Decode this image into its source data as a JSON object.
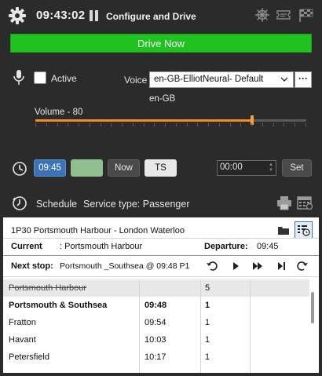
{
  "header": {
    "clock": "09:43:02",
    "title": "Configure and Drive",
    "icons": [
      "gear-icon",
      "pause-icon",
      "ship-wheel-icon",
      "ticket-icon",
      "checkered-flag-icon"
    ]
  },
  "drive_button": {
    "label": "Drive Now",
    "color": "#1fc21f"
  },
  "voice": {
    "active_label": "Active",
    "active_checked": false,
    "voice_label": "Voice",
    "selected": "en-GB-ElliotNeural- Default",
    "more_label": "···",
    "locale": "en-GB"
  },
  "volume": {
    "label": "Volume - 80",
    "value": 80,
    "max": 100,
    "accent": "#f28c1e"
  },
  "time_controls": {
    "time_button": "09:45",
    "now_button": "Now",
    "ts_button": "TS",
    "time_input": "00:00",
    "set_button": "Set"
  },
  "schedule": {
    "label": "Schedule",
    "service_type": "Service type: Passenger"
  },
  "journey": {
    "route": "1P30 Portsmouth Harbour - London Waterloo",
    "current_label": "Current",
    "current_value": ":  Portsmouth Harbour",
    "departure_label": "Departure:",
    "departure_value": "09:45",
    "next_stop_label": "Next stop:",
    "next_stop_value": "Portsmouth _Southsea @ 09:48 P1",
    "controls": [
      "undo-icon",
      "play-icon",
      "fast-forward-icon",
      "skip-to-end-icon",
      "redo-icon"
    ]
  },
  "stops": [
    {
      "name": "Portsmouth Harbour",
      "time": "",
      "platform": "5",
      "passed": true,
      "bold": false
    },
    {
      "name": "Portsmouth & Southsea",
      "time": "09:48",
      "platform": "1",
      "passed": false,
      "bold": true
    },
    {
      "name": "Fratton",
      "time": "09:54",
      "platform": "1",
      "passed": false,
      "bold": false
    },
    {
      "name": "Havant",
      "time": "10:03",
      "platform": "1",
      "passed": false,
      "bold": false
    },
    {
      "name": "Petersfield",
      "time": "10:17",
      "platform": "1",
      "passed": false,
      "bold": false
    }
  ]
}
